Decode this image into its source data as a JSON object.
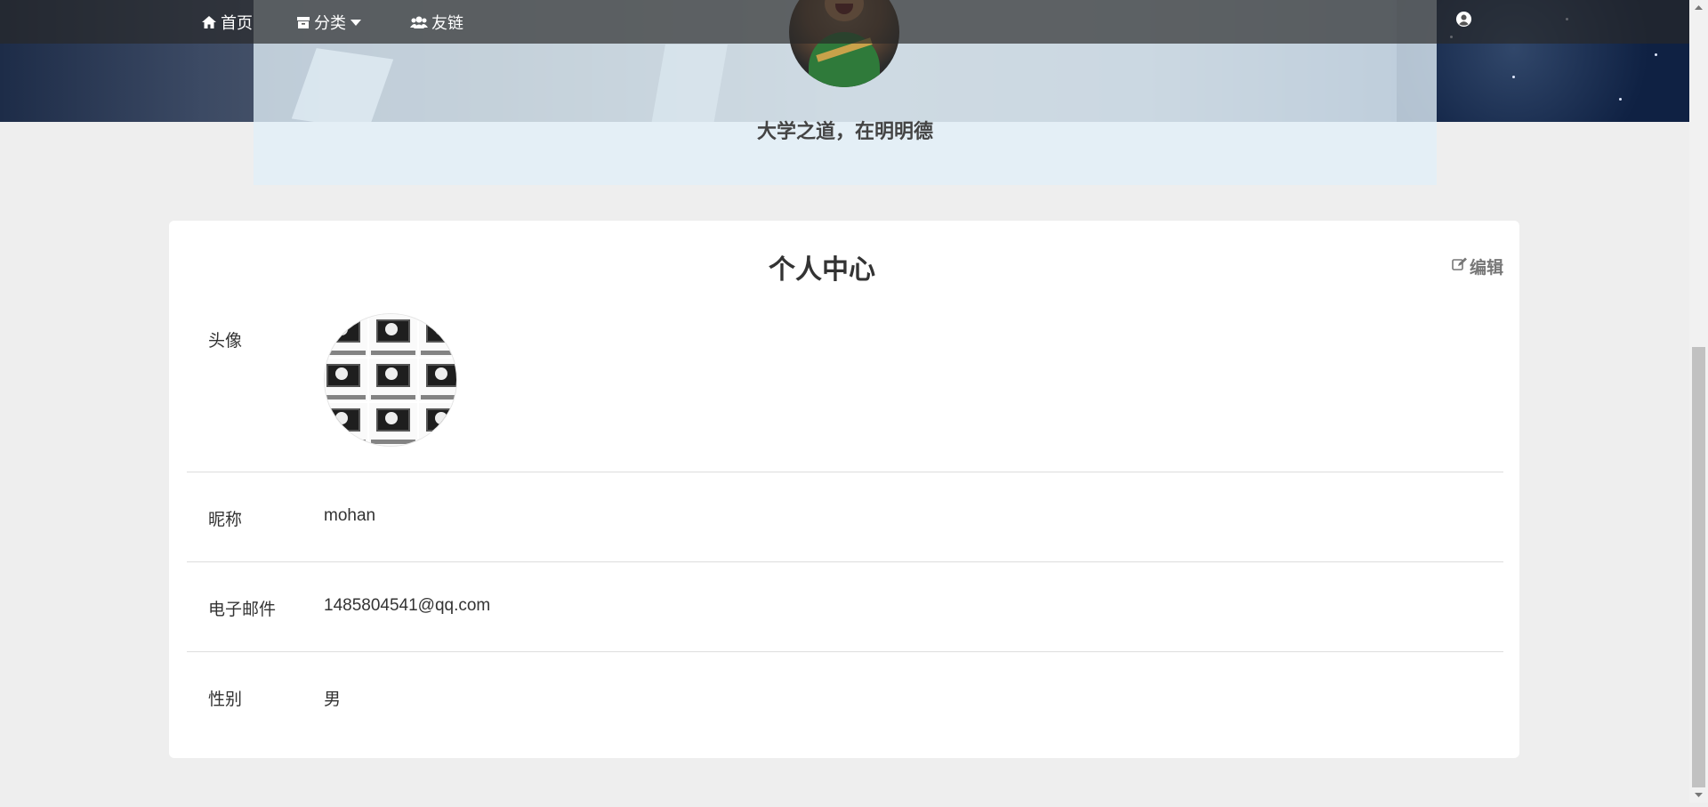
{
  "nav": {
    "home_label": "首页",
    "category_label": "分类",
    "links_label": "友链"
  },
  "header": {
    "motto": "大学之道，在明明德"
  },
  "profile": {
    "title": "个人中心",
    "edit_label": "编辑",
    "fields": {
      "avatar_label": "头像",
      "nickname_label": "昵称",
      "nickname_value": "mohan",
      "email_label": "电子邮件",
      "email_value": "1485804541@qq.com",
      "gender_label": "性别",
      "gender_value": "男"
    }
  },
  "icons": {
    "home": "home-icon",
    "category": "archive-icon",
    "dropdown": "caret-down-icon",
    "links": "users-icon",
    "user": "user-circle-icon",
    "edit": "edit-icon"
  }
}
